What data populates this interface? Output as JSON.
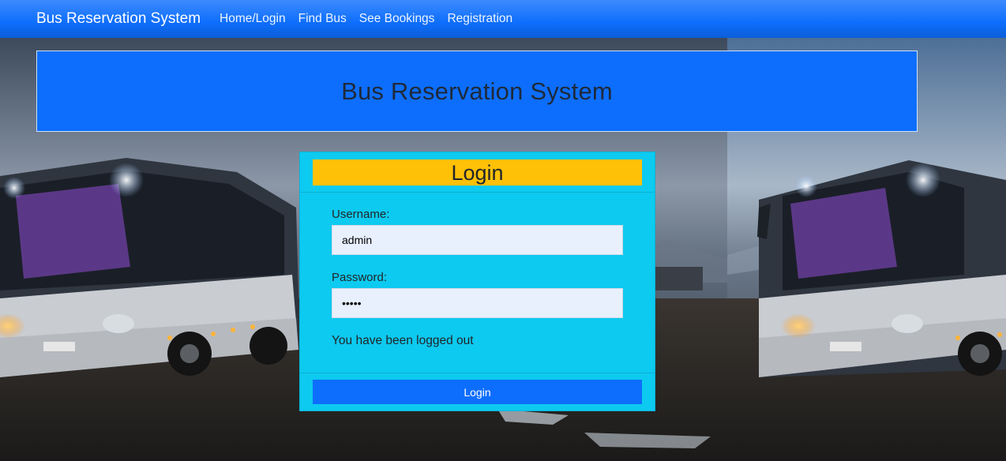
{
  "navbar": {
    "brand": "Bus Reservation System",
    "links": [
      "Home/Login",
      "Find Bus",
      "See Bookings",
      "Registration"
    ]
  },
  "banner": {
    "title": "Bus Reservation System"
  },
  "login_card": {
    "title": "Login",
    "username_label": "Username:",
    "username_value": "admin",
    "password_label": "Password:",
    "password_value": "•••••",
    "status_message": "You have been logged out",
    "submit_label": "Login"
  },
  "colors": {
    "navbar": "#0d6efd",
    "banner": "#0d6efd",
    "card": "#0dcaf0",
    "card_title": "#ffc107",
    "button": "#0d6efd",
    "input_bg": "#e8f0fe"
  },
  "background": {
    "image": "bus-photo-background"
  }
}
